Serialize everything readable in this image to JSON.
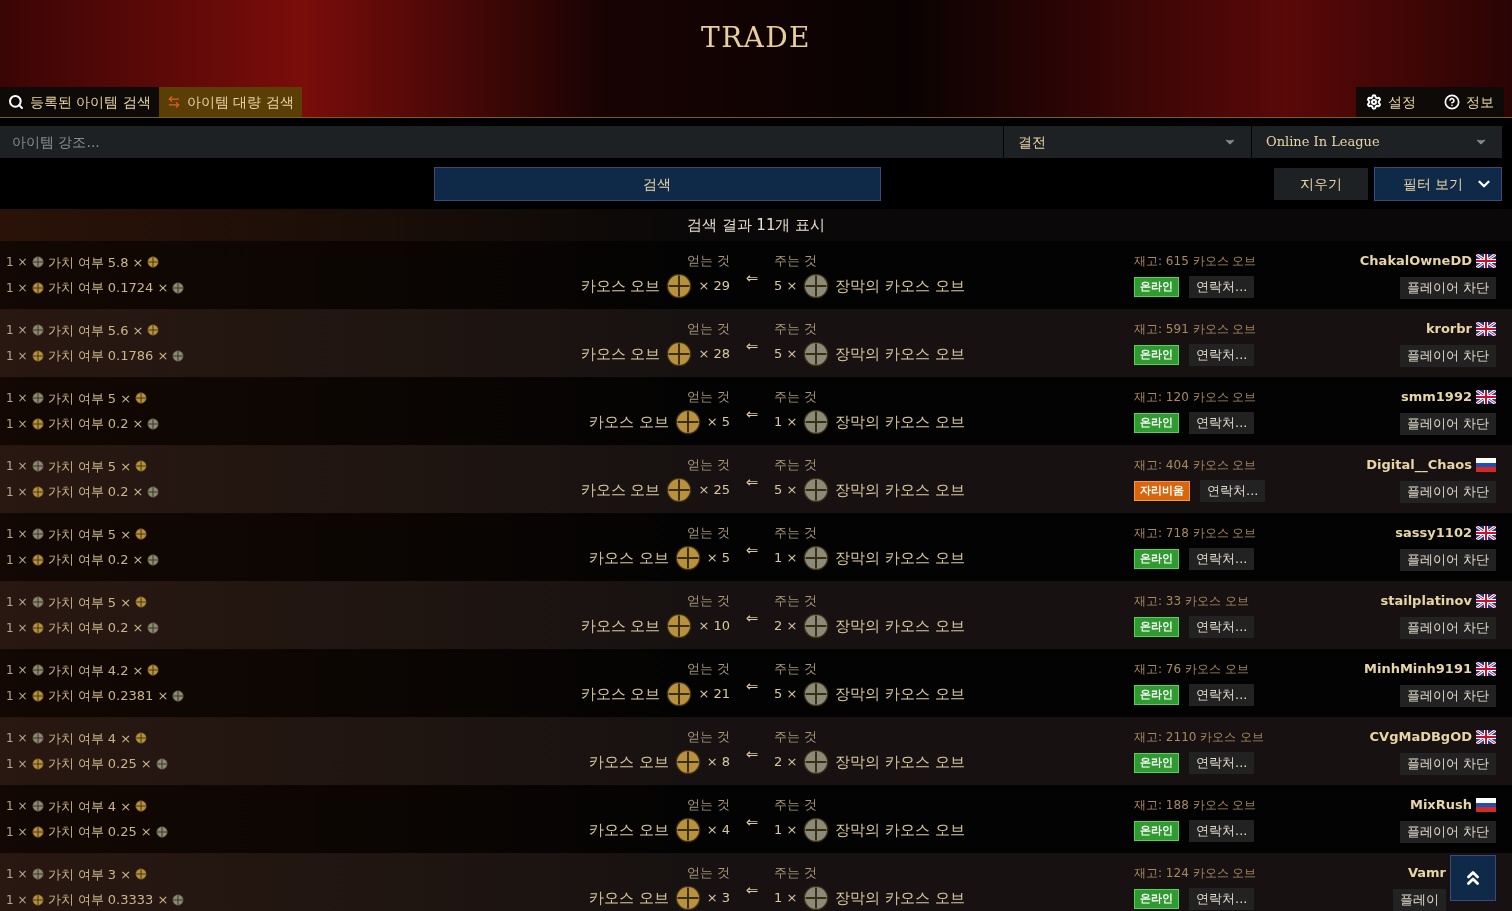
{
  "header": {
    "logo_text": "TRADE",
    "tabs": [
      {
        "label": "등록된 아이템 검색",
        "selected": false
      },
      {
        "label": "아이템 대량 검색",
        "selected": true
      }
    ],
    "links": [
      {
        "kind": "settings",
        "label": "설정"
      },
      {
        "kind": "help",
        "label": "정보"
      }
    ]
  },
  "filters": {
    "highlight_placeholder": "아이템 강조...",
    "league": "결전",
    "status": "Online In League"
  },
  "actions": {
    "search": "검색",
    "clear": "지우기",
    "filters": "필터 보기"
  },
  "results_title": "검색 결과 11개 표시",
  "rows": [
    {
      "ratio": [
        "1 ×",
        "가치 여부 5.8 ×",
        "1 ×",
        "가치 여부 0.1724 ×"
      ],
      "get_label": "얻는 것",
      "get_item": "카오스 오브",
      "get_qty": "× 29",
      "arrow": "⇐",
      "pay_label": "주는 것",
      "pay_qty": "5 ×",
      "pay_item": "장막의 카오스 오브",
      "stock": "재고: 615 카오스 오브",
      "status": {
        "kind": "online",
        "label": "온라인"
      },
      "contact": "연락처...",
      "player": "ChakalOwneDD",
      "flag": {
        "kind": "uk"
      },
      "block": "플레이어 차단"
    },
    {
      "ratio": [
        "1 ×",
        "가치 여부 5.6 ×",
        "1 ×",
        "가치 여부 0.1786 ×"
      ],
      "get_label": "얻는 것",
      "get_item": "카오스 오브",
      "get_qty": "× 28",
      "arrow": "⇐",
      "pay_label": "주는 것",
      "pay_qty": "5 ×",
      "pay_item": "장막의 카오스 오브",
      "stock": "재고: 591 카오스 오브",
      "status": {
        "kind": "online",
        "label": "온라인"
      },
      "contact": "연락처...",
      "player": "krorbr",
      "flag": {
        "kind": "uk"
      },
      "block": "플레이어 차단"
    },
    {
      "ratio": [
        "1 ×",
        "가치 여부 5 ×",
        "1 ×",
        "가치 여부 0.2 ×"
      ],
      "get_label": "얻는 것",
      "get_item": "카오스 오브",
      "get_qty": "× 5",
      "arrow": "⇐",
      "pay_label": "주는 것",
      "pay_qty": "1 ×",
      "pay_item": "장막의 카오스 오브",
      "stock": "재고: 120 카오스 오브",
      "status": {
        "kind": "online",
        "label": "온라인"
      },
      "contact": "연락처...",
      "player": "smm1992",
      "flag": {
        "kind": "uk"
      },
      "block": "플레이어 차단"
    },
    {
      "ratio": [
        "1 ×",
        "가치 여부 5 ×",
        "1 ×",
        "가치 여부 0.2 ×"
      ],
      "get_label": "얻는 것",
      "get_item": "카오스 오브",
      "get_qty": "× 25",
      "arrow": "⇐",
      "pay_label": "주는 것",
      "pay_qty": "5 ×",
      "pay_item": "장막의 카오스 오브",
      "stock": "재고: 404 카오스 오브",
      "status": {
        "kind": "afk",
        "label": "자리비움"
      },
      "contact": "연락처...",
      "player": "Digital__Chaos",
      "flag": {
        "kind": "ru"
      },
      "block": "플레이어 차단"
    },
    {
      "ratio": [
        "1 ×",
        "가치 여부 5 ×",
        "1 ×",
        "가치 여부 0.2 ×"
      ],
      "get_label": "얻는 것",
      "get_item": "카오스 오브",
      "get_qty": "× 5",
      "arrow": "⇐",
      "pay_label": "주는 것",
      "pay_qty": "1 ×",
      "pay_item": "장막의 카오스 오브",
      "stock": "재고: 718 카오스 오브",
      "status": {
        "kind": "online",
        "label": "온라인"
      },
      "contact": "연락처...",
      "player": "sassy1102",
      "flag": {
        "kind": "uk"
      },
      "block": "플레이어 차단"
    },
    {
      "ratio": [
        "1 ×",
        "가치 여부 5 ×",
        "1 ×",
        "가치 여부 0.2 ×"
      ],
      "get_label": "얻는 것",
      "get_item": "카오스 오브",
      "get_qty": "× 10",
      "arrow": "⇐",
      "pay_label": "주는 것",
      "pay_qty": "2 ×",
      "pay_item": "장막의 카오스 오브",
      "stock": "재고: 33 카오스 오브",
      "status": {
        "kind": "online",
        "label": "온라인"
      },
      "contact": "연락처...",
      "player": "stailplatinov",
      "flag": {
        "kind": "uk"
      },
      "block": "플레이어 차단"
    },
    {
      "ratio": [
        "1 ×",
        "가치 여부 4.2 ×",
        "1 ×",
        "가치 여부 0.2381 ×"
      ],
      "get_label": "얻는 것",
      "get_item": "카오스 오브",
      "get_qty": "× 21",
      "arrow": "⇐",
      "pay_label": "주는 것",
      "pay_qty": "5 ×",
      "pay_item": "장막의 카오스 오브",
      "stock": "재고: 76 카오스 오브",
      "status": {
        "kind": "online",
        "label": "온라인"
      },
      "contact": "연락처...",
      "player": "MinhMinh9191",
      "flag": {
        "kind": "uk"
      },
      "block": "플레이어 차단"
    },
    {
      "ratio": [
        "1 ×",
        "가치 여부 4 ×",
        "1 ×",
        "가치 여부 0.25 ×"
      ],
      "get_label": "얻는 것",
      "get_item": "카오스 오브",
      "get_qty": "× 8",
      "arrow": "⇐",
      "pay_label": "주는 것",
      "pay_qty": "2 ×",
      "pay_item": "장막의 카오스 오브",
      "stock": "재고: 2110 카오스 오브",
      "status": {
        "kind": "online",
        "label": "온라인"
      },
      "contact": "연락처...",
      "player": "CVgMaDBgOD",
      "flag": {
        "kind": "uk"
      },
      "block": "플레이어 차단"
    },
    {
      "ratio": [
        "1 ×",
        "가치 여부 4 ×",
        "1 ×",
        "가치 여부 0.25 ×"
      ],
      "get_label": "얻는 것",
      "get_item": "카오스 오브",
      "get_qty": "× 4",
      "arrow": "⇐",
      "pay_label": "주는 것",
      "pay_qty": "1 ×",
      "pay_item": "장막의 카오스 오브",
      "stock": "재고: 188 카오스 오브",
      "status": {
        "kind": "online",
        "label": "온라인"
      },
      "contact": "연락처...",
      "player": "MixRush",
      "flag": {
        "kind": "ru"
      },
      "block": "플레이어 차단"
    },
    {
      "ratio": [
        "1 ×",
        "가치 여부 3 ×",
        "1 ×",
        "가치 여부 0.3333 ×"
      ],
      "get_label": "얻는 것",
      "get_item": "카오스 오브",
      "get_qty": "× 3",
      "arrow": "⇐",
      "pay_label": "주는 것",
      "pay_qty": "1 ×",
      "pay_item": "장막의 카오스 오브",
      "stock": "재고: 124 카오스 오브",
      "status": {
        "kind": "online",
        "label": "온라인"
      },
      "contact": "연락처...",
      "player": "Vamr",
      "block": "플레이"
    }
  ]
}
